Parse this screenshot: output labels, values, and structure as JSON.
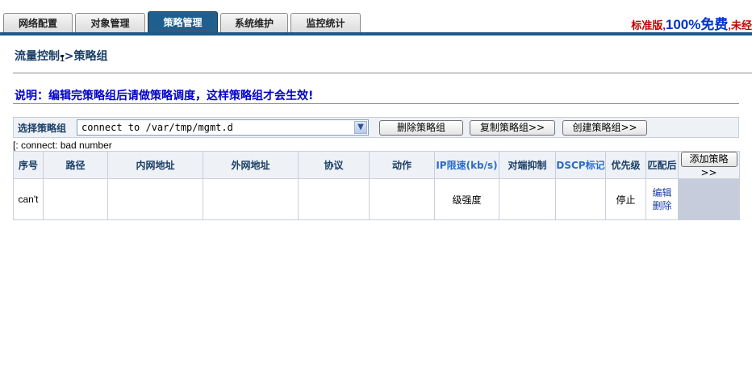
{
  "tabs": [
    {
      "label": "网络配置",
      "active": false
    },
    {
      "label": "对象管理",
      "active": false
    },
    {
      "label": "策略管理",
      "active": true
    },
    {
      "label": "系统维护",
      "active": false
    },
    {
      "label": "监控统计",
      "active": false
    }
  ],
  "promo": {
    "part1": "标准版,",
    "part2": "100%免费",
    "part3": ",未经"
  },
  "breadcrumb": "流量控制->策略组",
  "note": "说明：编辑完策略组后请做策略调度，这样策略组才会生效!",
  "group_bar": {
    "label": "选择策略组",
    "select_value": "connect to /var/tmp/mgmt.d",
    "delete_button": "删除策略组",
    "copy_button": "复制策略组>>",
    "create_button": "创建策略组>>"
  },
  "error_text": "[: connect: bad number",
  "table": {
    "headers": {
      "seq": "序号",
      "path": "路径",
      "inner_addr": "内网地址",
      "outer_addr": "外网地址",
      "protocol": "协议",
      "action": "动作",
      "ip_limit": "IP限速(kb/s)",
      "suppress": "对端抑制",
      "dscp": "DSCP标记",
      "priority": "优先级",
      "match_after": "匹配后",
      "add_button": "添加策略>>"
    },
    "row": {
      "seq": "can't",
      "ip_limit": "级强度",
      "priority": "停止",
      "edit": "编辑",
      "delete": "删除"
    }
  },
  "colors": {
    "tab_active_bg": "#1f5f8f",
    "top_line": "#1b5a8a",
    "note_text": "#0000cc",
    "promo_red": "#c00000",
    "promo_blue": "#0033cc"
  }
}
